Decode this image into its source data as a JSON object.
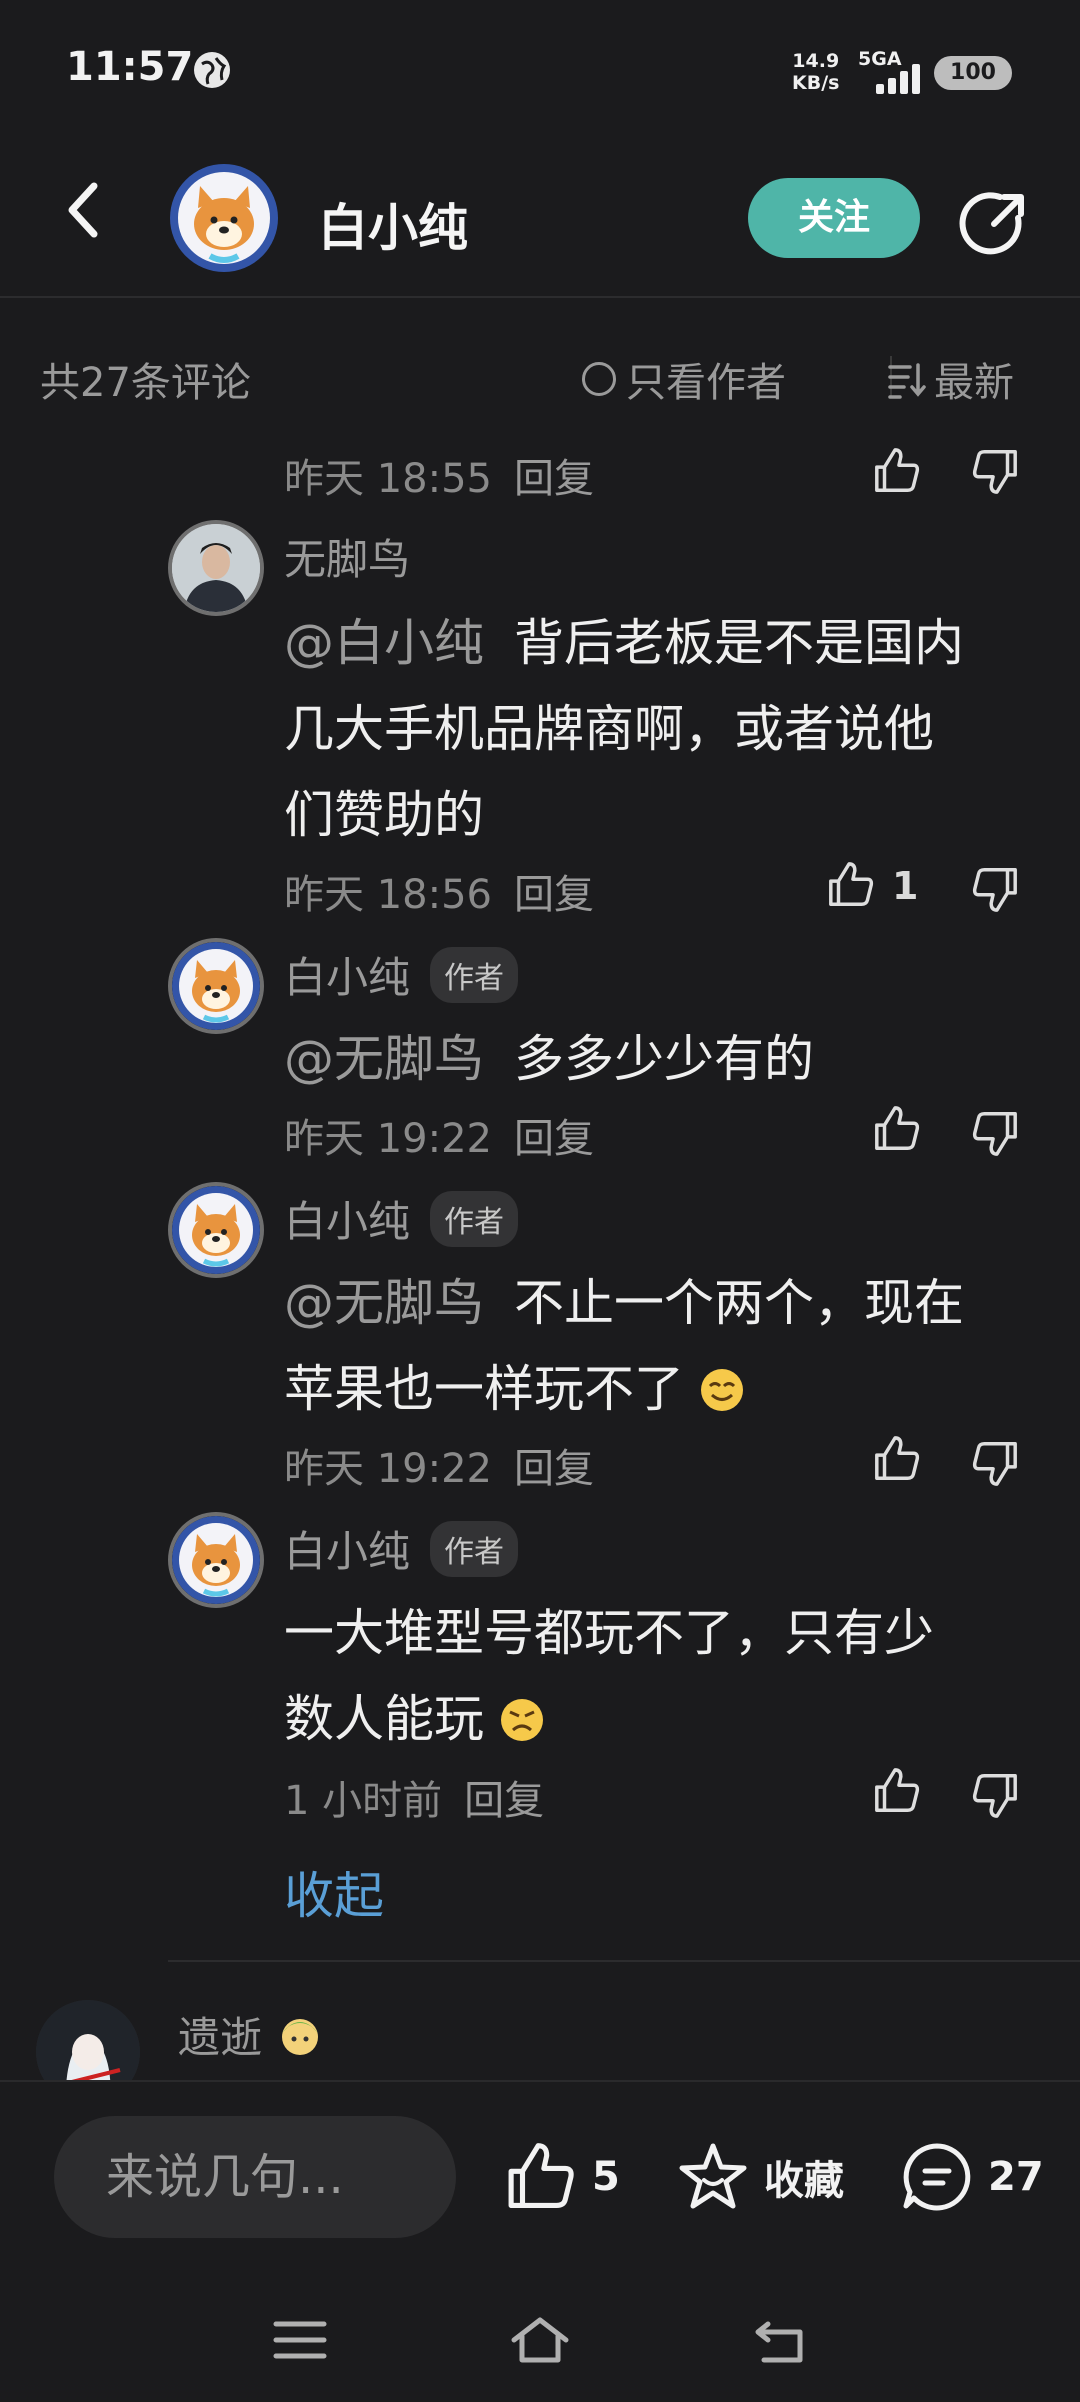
{
  "status_bar": {
    "time": "11:57",
    "net_speed_value": "14.9",
    "net_speed_unit": "KB/s",
    "signal": "5GA",
    "battery": "100"
  },
  "header": {
    "title": "白小纯",
    "follow_label": "关注"
  },
  "sort_bar": {
    "count_label": "共27条评论",
    "author_only_label": "只看作者",
    "sort_label": "最新"
  },
  "comments": [
    {
      "meta_time": "昨天 18:55",
      "reply_label": "回复"
    },
    {
      "name": "无脚鸟",
      "mention": "@白小纯",
      "text_l1": "背后老板是不是国内",
      "text_l2": "几大手机品牌商啊，或者说他",
      "text_l3": "们赞助的",
      "meta_time": "昨天 18:56",
      "reply_label": "回复",
      "likes": "1"
    },
    {
      "name": "白小纯",
      "tag": "作者",
      "mention": "@无脚鸟",
      "text_l1": "多多少少有的",
      "meta_time": "昨天 19:22",
      "reply_label": "回复"
    },
    {
      "name": "白小纯",
      "tag": "作者",
      "mention": "@无脚鸟",
      "text_l1": "不止一个两个，现在",
      "text_l2": "苹果也一样玩不了",
      "meta_time": "昨天 19:22",
      "reply_label": "回复"
    },
    {
      "name": "白小纯",
      "tag": "作者",
      "text_l1": "一大堆型号都玩不了，只有少",
      "text_l2": "数人能玩",
      "meta_time": "1 小时前",
      "reply_label": "回复"
    }
  ],
  "collapse_label": "收起",
  "next_comment": {
    "name": "遗逝"
  },
  "bottom_bar": {
    "input_placeholder": "来说几句...",
    "likes": "5",
    "favorite_label": "收藏",
    "comments": "27"
  },
  "colors": {
    "accent": "#4fb5a8",
    "link": "#5a9fd6",
    "background": "#1b1b1d"
  }
}
